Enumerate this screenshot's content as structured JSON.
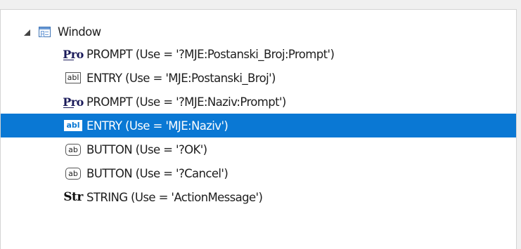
{
  "tree": {
    "root": {
      "label": "Window",
      "icon": "window-icon",
      "expanded": true
    },
    "children": [
      {
        "icon_text": "Pro",
        "icon": "prompt-icon",
        "label": "PROMPT (Use = '?MJE:Postanski_Broj:Prompt')"
      },
      {
        "icon_text": "abl",
        "icon": "entry-icon",
        "label": "ENTRY (Use = 'MJE:Postanski_Broj')"
      },
      {
        "icon_text": "Pro",
        "icon": "prompt-icon",
        "label": "PROMPT (Use = '?MJE:Naziv:Prompt')"
      },
      {
        "icon_text": "abl",
        "icon": "entry-icon",
        "label": "ENTRY (Use = 'MJE:Naziv')",
        "selected": true
      },
      {
        "icon_text": "ab",
        "icon": "button-icon",
        "label": "BUTTON (Use = '?OK')"
      },
      {
        "icon_text": "ab",
        "icon": "button-icon",
        "label": "BUTTON (Use = '?Cancel')"
      },
      {
        "icon_text": "Str",
        "icon": "string-icon",
        "label": "STRING (Use = 'ActionMessage')"
      }
    ]
  },
  "colors": {
    "selection": "#0a78d4",
    "background": "#ffffff",
    "frame": "#f0f0f0"
  }
}
